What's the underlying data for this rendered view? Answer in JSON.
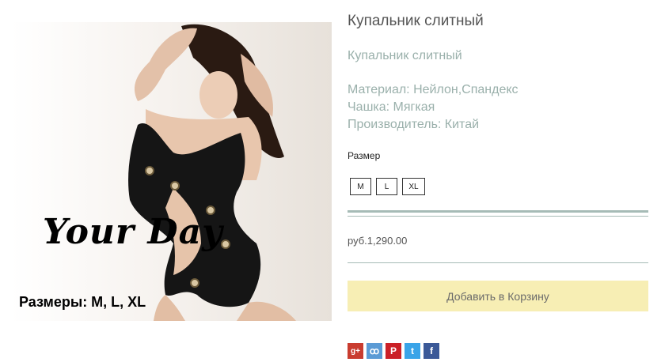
{
  "image": {
    "brand": "Your Day",
    "sizes_caption": "Размеры: M, L, XL"
  },
  "product": {
    "title": "Купальник слитный",
    "subtitle": "Купальник слитный",
    "material": "Материал: Нейлон,Спандекс",
    "cup": "Чашка: Мягкая",
    "manufacturer": "Производитель: Китай"
  },
  "size_selector": {
    "label": "Размер",
    "options": [
      "M",
      "L",
      "XL"
    ]
  },
  "price": "руб.1,290.00",
  "add_to_cart": "Добавить в Корзину",
  "share": [
    {
      "icon": "google-plus-icon",
      "glyph": "g+"
    },
    {
      "icon": "odnoklassniki-icon",
      "glyph": "ꝏ"
    },
    {
      "icon": "pinterest-icon",
      "glyph": "P"
    },
    {
      "icon": "twitter-icon",
      "glyph": "t"
    },
    {
      "icon": "facebook-icon",
      "glyph": "f"
    }
  ],
  "colors": {
    "accent_rule": "#a6bbb6",
    "description_text": "#9ab0ab",
    "cart_button_bg": "#f7eeb4"
  }
}
